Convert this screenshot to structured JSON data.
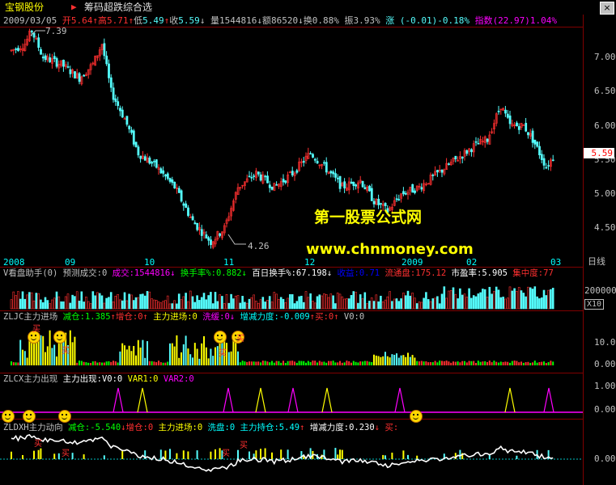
{
  "window": {
    "stock_name": "宝钢股份",
    "formula_arrow": "▶",
    "formula_name": "筹码超跌综合选",
    "close_label": "×"
  },
  "price_info": {
    "date": "2009/03/05",
    "open_label": "开",
    "open": "5.64",
    "open_arrow": "↑",
    "high_label": "高",
    "high": "5.71",
    "high_arrow": "↑",
    "low_label": "低",
    "low": "5.49",
    "low_arrow": "↑",
    "close_label": "收",
    "close": "5.59",
    "close_arrow": "↓",
    "vol_label": "量",
    "vol": "1544816",
    "vol_arrow": "↓",
    "amount_label": "额",
    "amount": "86520",
    "amount_arrow": "↓",
    "turnover_label": "换",
    "turnover": "0.88%",
    "amplitude_label": "振",
    "amplitude": "3.93%",
    "change_label": "涨",
    "change": "(-0.01)-0.18%",
    "index_label": "指数",
    "index": "(22.97)1.04%"
  },
  "price_axis": {
    "labels": [
      "7.00",
      "6.50",
      "6.00",
      "5.50",
      "5.00",
      "4.50"
    ],
    "current_price": "5.59",
    "high_mark": "7.39",
    "low_mark": "4.26"
  },
  "date_axis": {
    "labels": [
      "2008",
      "09",
      "10",
      "11",
      "12",
      "2009",
      "02",
      "03"
    ],
    "period_label": "日线"
  },
  "watermark": {
    "line1": "第一股票公式网",
    "line2": "www.chnmoney.com"
  },
  "panel_volume": {
    "name": "V看盘助手(0)",
    "forecast_label": "预测成交:0",
    "vol_label": "成交:1544816",
    "vol_arrow": "↓",
    "turnover_label": "换手率%:0.882",
    "turnover_arrow": "↓",
    "hundred_label": "百日换手%:67.198",
    "hundred_arrow": "↓",
    "profit_label": "收益:0.71",
    "float_label": "流通盘:175.12",
    "pe_label": "市盈率:5.905",
    "conc_label": "集中度:77",
    "axis_value": "200000",
    "axis_unit": "X10"
  },
  "panel_zljc": {
    "name": "ZLJC主力进场",
    "reduce": "减仓:1.385",
    "reduce_arrow": "↑",
    "add": "增仓:0",
    "add_arrow": "↑",
    "main_in": "主力进场:0",
    "wash": "洗缓:0",
    "wash_arrow": "↓",
    "force": "增减力度:-0.009",
    "force_arrow": "↑",
    "buy": "买:0",
    "buy_arrow": "↑",
    "v0": "V0:0",
    "axis": [
      "10.00",
      "0.00"
    ],
    "buy_mark": "买"
  },
  "panel_zlcx": {
    "name": "ZLCX主力出现",
    "main_appear": "主力出现:V0:0",
    "var1": "VAR1:0",
    "var2": "VAR2:0",
    "axis": [
      "1.00",
      "0.00"
    ]
  },
  "panel_zldx": {
    "name": "ZLDXH主力动向",
    "reduce": "减仓:-5.540",
    "reduce_arrow": "↓",
    "add": "增仓:0",
    "main_in": "主力进场:0",
    "wash": "洗盘:0",
    "hold": "主力持仓:5.49",
    "hold_arrow": "↑",
    "force": "增减力度:0.230",
    "force_arrow": "↓",
    "buy": "买:",
    "axis": [
      "0.00"
    ],
    "buy_mark": "买"
  },
  "colors": {
    "up": "#ff3030",
    "down": "#54fcfc",
    "grid": "#800000",
    "yellow": "#ffff00",
    "magenta": "#ff00ff",
    "green": "#00ff00",
    "white": "#ffffff"
  }
}
